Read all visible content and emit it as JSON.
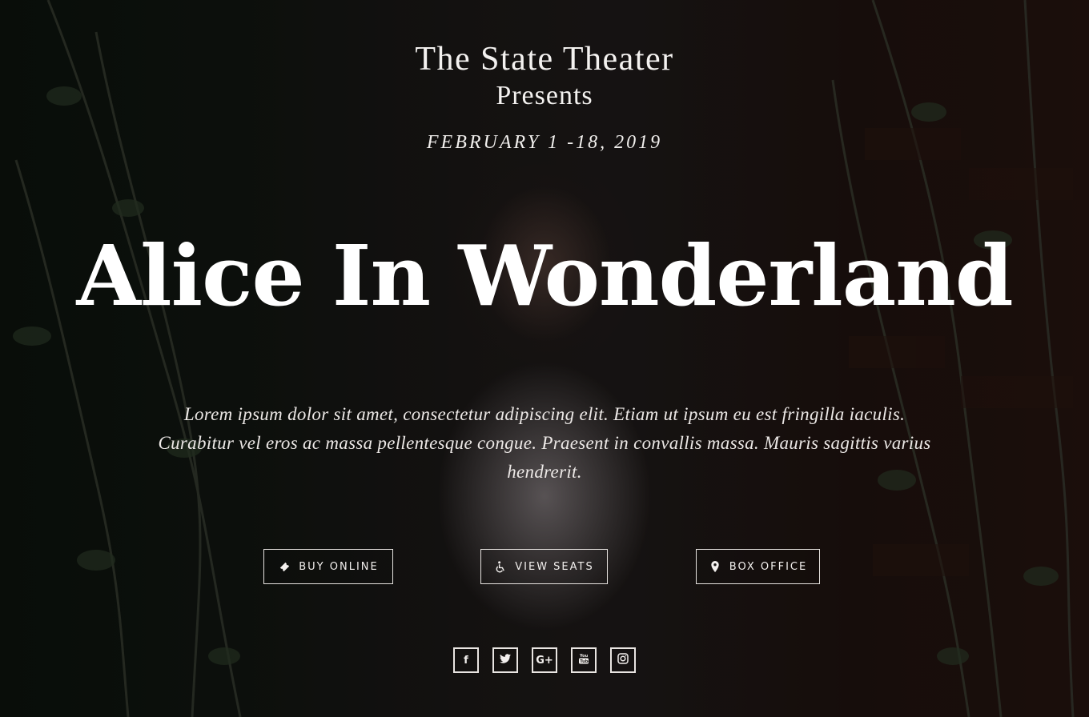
{
  "header": {
    "theater_name": "The State Theater",
    "presents": "Presents",
    "dates": "FEBRUARY 1 -18, 2019"
  },
  "show": {
    "title": "Alice In Wonderland",
    "description": "Lorem ipsum dolor sit amet, consectetur adipiscing elit. Etiam ut ipsum eu est fringilla iaculis. Curabitur vel eros ac massa pellentesque congue. Praesent in convallis massa. Mauris sagittis varius hendrerit."
  },
  "actions": {
    "buy_online": {
      "label": "BUY ONLINE",
      "icon": "ticket-icon"
    },
    "view_seats": {
      "label": "VIEW SEATS",
      "icon": "wheelchair-icon"
    },
    "box_office": {
      "label": "BOX OFFICE",
      "icon": "map-marker-icon"
    }
  },
  "social": [
    {
      "icon": "facebook-icon",
      "glyph": "f"
    },
    {
      "icon": "twitter-icon",
      "glyph": "t"
    },
    {
      "icon": "google-plus-icon",
      "glyph": "G+"
    },
    {
      "icon": "youtube-icon",
      "glyph": "You"
    },
    {
      "icon": "instagram-icon",
      "glyph": ""
    }
  ],
  "colors": {
    "text": "#ffffff",
    "border": "#e6e2df",
    "background": "#0e0c0b"
  }
}
